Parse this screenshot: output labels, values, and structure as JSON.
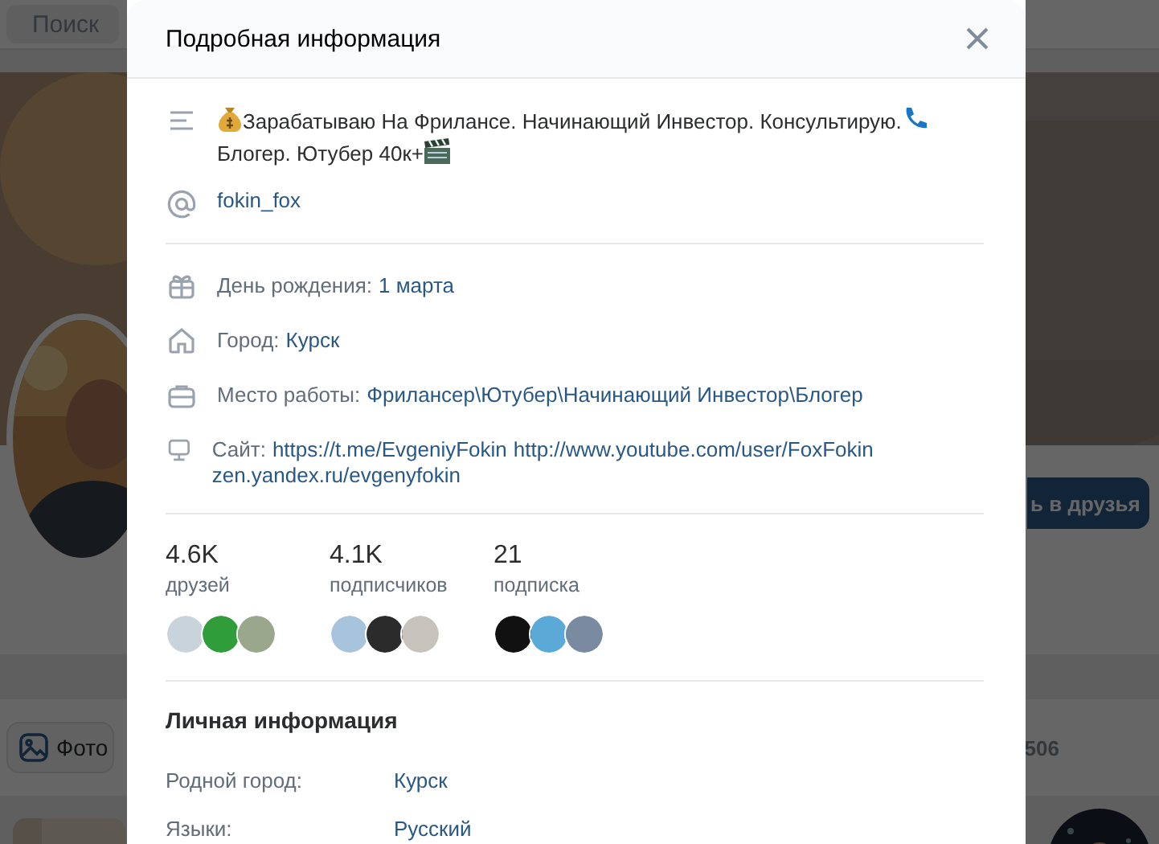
{
  "background": {
    "search": {
      "placeholder": "Поиск"
    },
    "add_friend_button": "ь в друзья",
    "photo_button": "Фото",
    "count": "506"
  },
  "modal": {
    "title": "Подробная информация",
    "status": [
      "Зарабатываю На Фрилансе. Начинающий Инвестор. Консультирую.",
      "Блогер. Ютубер 40к+"
    ],
    "nickname": "fokin_fox",
    "info": [
      {
        "kind": "birthday",
        "label": "День рождения:",
        "values": [
          "1 марта"
        ]
      },
      {
        "kind": "city",
        "label": "Город:",
        "values": [
          "Курск"
        ]
      },
      {
        "kind": "work",
        "label": "Место работы:",
        "values": [
          "Фрилансер\\Ютубер\\Начинающий Инвестор\\Блогер"
        ]
      },
      {
        "kind": "site",
        "label": "Сайт:",
        "values": [
          "https://t.me/EvgeniyFokin",
          "http://www.youtube.com/user/FoxFokin",
          "zen.yandex.ru/evgenyfokin"
        ]
      }
    ],
    "counters": [
      {
        "value": "4.6K",
        "label": "друзей"
      },
      {
        "value": "4.1K",
        "label": "подписчиков"
      },
      {
        "value": "21",
        "label": "подписка"
      }
    ],
    "personal": {
      "title": "Личная информация",
      "rows": [
        {
          "label": "Родной город:",
          "value": "Курск"
        },
        {
          "label": "Языки:",
          "value": "Русский"
        }
      ]
    }
  }
}
